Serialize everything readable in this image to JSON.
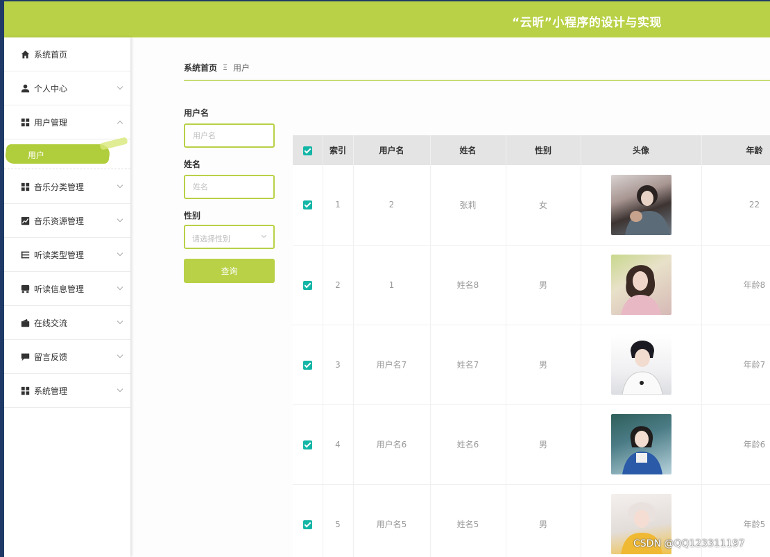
{
  "app": {
    "title": "“云昕”小程序的设计与实现"
  },
  "sidebar": {
    "items": [
      {
        "label": "系统首页",
        "icon": "home-icon"
      },
      {
        "label": "个人中心",
        "icon": "person-icon"
      },
      {
        "label": "用户管理",
        "icon": "grid-icon"
      },
      {
        "label": "音乐分类管理",
        "icon": "grid-icon"
      },
      {
        "label": "音乐资源管理",
        "icon": "chart-icon"
      },
      {
        "label": "听读类型管理",
        "icon": "list-icon"
      },
      {
        "label": "听读信息管理",
        "icon": "inbox-icon"
      },
      {
        "label": "在线交流",
        "icon": "wallet-icon"
      },
      {
        "label": "留言反馈",
        "icon": "comment-icon"
      },
      {
        "label": "系统管理",
        "icon": "grid-icon"
      }
    ],
    "submenu_active": "用户"
  },
  "breadcrumb": {
    "home": "系统首页",
    "separator": "Ξ",
    "current": "用户"
  },
  "search": {
    "username_label": "用户名",
    "username_placeholder": "用户名",
    "name_label": "姓名",
    "name_placeholder": "姓名",
    "gender_label": "性别",
    "gender_placeholder": "请选择性别",
    "query_button": "查询"
  },
  "table": {
    "columns": [
      "索引",
      "用户名",
      "姓名",
      "性别",
      "头像",
      "年龄"
    ],
    "rows": [
      {
        "index": "1",
        "username": "2",
        "name": "张莉",
        "gender": "女",
        "age": "22"
      },
      {
        "index": "2",
        "username": "1",
        "name": "姓名8",
        "gender": "男",
        "age": "年龄8"
      },
      {
        "index": "3",
        "username": "用户名7",
        "name": "姓名7",
        "gender": "男",
        "age": "年龄7"
      },
      {
        "index": "4",
        "username": "用户名6",
        "name": "姓名6",
        "gender": "男",
        "age": "年龄6"
      },
      {
        "index": "5",
        "username": "用户名5",
        "name": "姓名5",
        "gender": "男",
        "age": "年龄5"
      }
    ]
  },
  "colors": {
    "accent": "#b8d146",
    "checkbox": "#13b5a6",
    "header_bg": "#e4e4e4"
  },
  "watermark": "CSDN @QQ123311197"
}
